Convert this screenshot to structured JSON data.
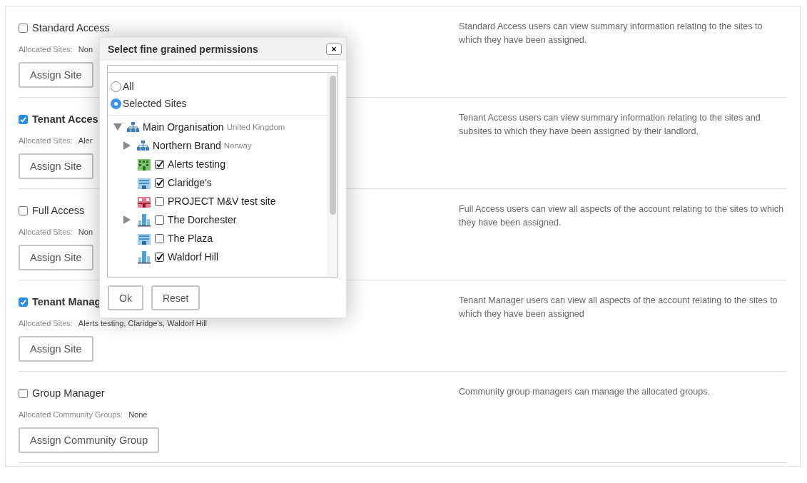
{
  "roles": [
    {
      "label": "Standard Access",
      "checked": false,
      "allocated_label": "Allocated Sites:",
      "allocated_value": "Non",
      "button": "Assign Site",
      "description": "Standard Access users can view summary information relating to the sites to which they have been assigned."
    },
    {
      "label": "Tenant Acces",
      "checked": true,
      "allocated_label": "Allocated Sites:",
      "allocated_value": "Aler",
      "button": "Assign Site",
      "description": "Tenant Access users can view summary information relating to the sites and subsites to which they have been assigned by their landlord."
    },
    {
      "label": "Full Access",
      "checked": false,
      "allocated_label": "Allocated Sites:",
      "allocated_value": "Non",
      "button": "Assign Site",
      "description": "Full Access users can view all aspects of the account relating to the sites to which they have been assigned."
    },
    {
      "label": "Tenant Manag",
      "checked": true,
      "allocated_label": "Allocated Sites:",
      "allocated_value": "Alerts testing, Claridge's, Waldorf Hill",
      "button": "Assign Site",
      "description": "Tenant Manager users can view all aspects of the account relating to the sites to which they have been assigned"
    },
    {
      "label": "Group Manager",
      "checked": false,
      "allocated_label": "Allocated Community Groups:",
      "allocated_value": "None",
      "button": "Assign Community Group",
      "description": "Community group managers can manage the allocated groups."
    }
  ],
  "dialog": {
    "title": "Select fine grained permissions",
    "close": "×",
    "scope": [
      {
        "label": "All",
        "selected": false
      },
      {
        "label": "Selected Sites",
        "selected": true
      }
    ],
    "tree": [
      {
        "kind": "org",
        "name": "Main Organisation",
        "region": "United Kingdom",
        "expanded": true,
        "children": [
          {
            "kind": "org",
            "name": "Northern Brand",
            "region": "Norway",
            "expanded": false
          },
          {
            "kind": "site",
            "name": "Alerts testing",
            "checked": true
          },
          {
            "kind": "site",
            "name": "Claridge's",
            "checked": true
          },
          {
            "kind": "site",
            "name": "PROJECT M&V test site",
            "checked": false
          },
          {
            "kind": "site",
            "name": "The Dorchester",
            "checked": false,
            "expanded": false
          },
          {
            "kind": "site",
            "name": "The Plaza",
            "checked": false
          },
          {
            "kind": "site",
            "name": "Waldorf Hill",
            "checked": true
          }
        ]
      }
    ],
    "buttons": [
      "Ok",
      "Reset"
    ]
  }
}
